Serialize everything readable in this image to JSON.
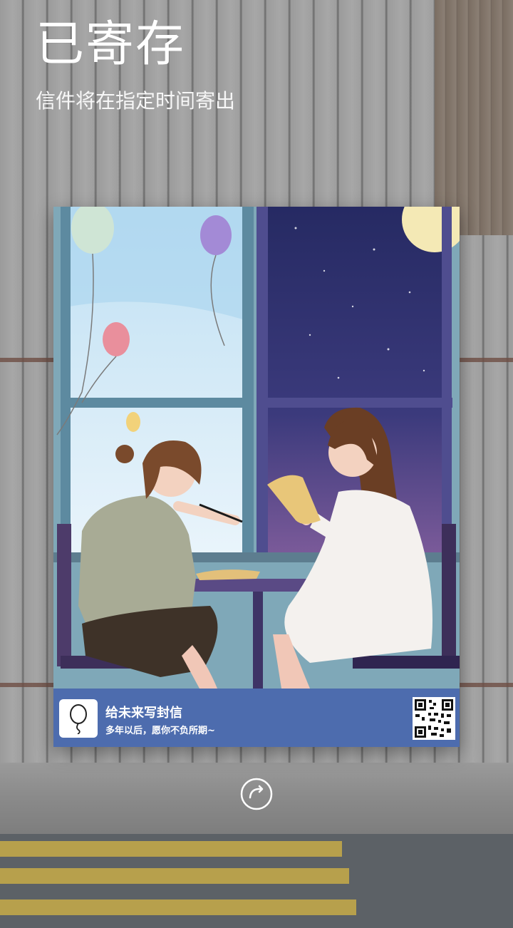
{
  "header": {
    "title": "已寄存",
    "subtitle": "信件将在指定时间寄出"
  },
  "card": {
    "footer_title": "给未来写封信",
    "footer_subtitle": "多年以后，愿你不负所期~"
  },
  "icons": {
    "refresh": "refresh-icon",
    "logo": "balloon-icon",
    "qr": "qr-code"
  },
  "colors": {
    "card_footer": "#4d6cae",
    "text": "#ffffff"
  }
}
